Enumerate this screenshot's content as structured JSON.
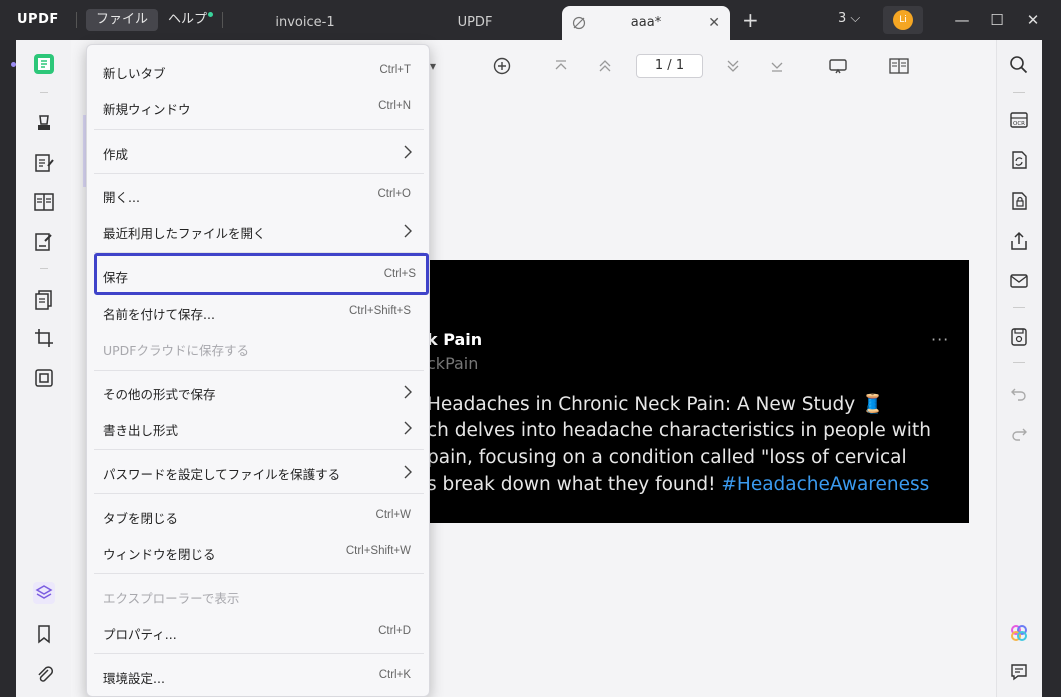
{
  "titlebar": {
    "logo_main": "UPDF",
    "menus": {
      "file": "ファイル",
      "help": "ヘルプ"
    },
    "tabs": [
      {
        "label": "invoice-1"
      },
      {
        "label": "UPDF"
      },
      {
        "label": "aaa*"
      }
    ],
    "tab_count": "3",
    "avatar_initials": "Li"
  },
  "toolbar": {
    "page_indicator": "1  /  1"
  },
  "file_menu": {
    "items": [
      {
        "label": "新しいタブ",
        "shortcut": "Ctrl+T"
      },
      {
        "label": "新規ウィンドウ",
        "shortcut": "Ctrl+N"
      },
      {
        "label": "作成",
        "submenu": true
      },
      {
        "label": "開く...",
        "shortcut": "Ctrl+O"
      },
      {
        "label": "最近利用したファイルを開く",
        "submenu": true
      },
      {
        "label": "保存",
        "shortcut": "Ctrl+S",
        "highlighted": true
      },
      {
        "label": "名前を付けて保存...",
        "shortcut": "Ctrl+Shift+S"
      },
      {
        "label": "UPDFクラウドに保存する",
        "disabled": true
      },
      {
        "label": "その他の形式で保存",
        "submenu": true
      },
      {
        "label": "書き出し形式",
        "submenu": true
      },
      {
        "label": "パスワードを設定してファイルを保護する",
        "submenu": true
      },
      {
        "label": "タブを閉じる",
        "shortcut": "Ctrl+W"
      },
      {
        "label": "ウィンドウを閉じる",
        "shortcut": "Ctrl+Shift+W"
      },
      {
        "label": "エクスプローラーで表示",
        "disabled": true
      },
      {
        "label": "プロパティ...",
        "shortcut": "Ctrl+D"
      },
      {
        "label": "環境設定...",
        "shortcut": "Ctrl+K"
      }
    ]
  },
  "document": {
    "tweet": {
      "name": "k Pain",
      "handle": "ckPain",
      "lines": [
        "Headaches in Chronic Neck Pain: A New Study 🧵",
        "ch delves into headache characteristics in people with",
        "pain, focusing on a condition called \"loss of cervical",
        "s break down what they found! "
      ],
      "hashtag": "#HeadacheAwareness"
    }
  },
  "colors": {
    "accent": "#3f43c9",
    "titlebar_bg": "#2b2b2f",
    "avatar": "#f5a623"
  }
}
